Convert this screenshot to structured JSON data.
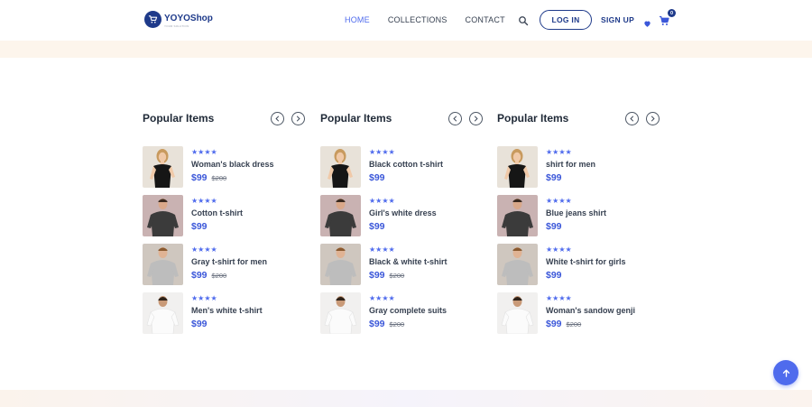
{
  "header": {
    "logo": {
      "brand_bold": "YOYO",
      "brand_rest": "Shop",
      "tagline": "YOUR SOLUTION"
    },
    "nav": [
      {
        "label": "HOME",
        "active": true
      },
      {
        "label": "COLLECTIONS",
        "active": false
      },
      {
        "label": "CONTACT",
        "active": false
      }
    ],
    "login_label": "LOG IN",
    "signup_label": "SIGN UP",
    "cart_count": "0",
    "icons": [
      "search-icon",
      "heart-icon",
      "cart-icon"
    ]
  },
  "colors": {
    "accent": "#4f6bed",
    "brand": "#1e3a8a",
    "band": "#fdf5ec"
  },
  "columns": [
    {
      "title": "Popular Items",
      "items": [
        {
          "rating": "★★★★",
          "name": "Woman's black dress",
          "price": "$99",
          "old_price": "$200",
          "image": "woman-black-dress"
        },
        {
          "rating": "★★★★",
          "name": "Cotton t-shirt",
          "price": "$99",
          "old_price": "",
          "image": "man-dark-tshirt"
        },
        {
          "rating": "★★★★",
          "name": "Gray t-shirt for men",
          "price": "$99",
          "old_price": "$200",
          "image": "man-gray-tshirt"
        },
        {
          "rating": "★★★★",
          "name": "Men's white t-shirt",
          "price": "$99",
          "old_price": "",
          "image": "man-white-tshirt"
        }
      ]
    },
    {
      "title": "Popular Items",
      "items": [
        {
          "rating": "★★★★",
          "name": "Black cotton t-shirt",
          "price": "$99",
          "old_price": "",
          "image": "woman-black-dress"
        },
        {
          "rating": "★★★★",
          "name": "Girl's white dress",
          "price": "$99",
          "old_price": "",
          "image": "man-dark-tshirt"
        },
        {
          "rating": "★★★★",
          "name": "Black & white t-shirt",
          "price": "$99",
          "old_price": "$200",
          "image": "man-gray-tshirt"
        },
        {
          "rating": "★★★★",
          "name": "Gray complete suits",
          "price": "$99",
          "old_price": "$200",
          "image": "man-white-tshirt"
        }
      ]
    },
    {
      "title": "Popular Items",
      "items": [
        {
          "rating": "★★★★",
          "name": "shirt for men",
          "price": "$99",
          "old_price": "",
          "image": "woman-black-dress"
        },
        {
          "rating": "★★★★",
          "name": "Blue jeans shirt",
          "price": "$99",
          "old_price": "",
          "image": "man-dark-tshirt"
        },
        {
          "rating": "★★★★",
          "name": "White t-shirt for girls",
          "price": "$99",
          "old_price": "",
          "image": "man-gray-tshirt"
        },
        {
          "rating": "★★★★",
          "name": "Woman's sandow genji",
          "price": "$99",
          "old_price": "$200",
          "image": "man-white-tshirt"
        }
      ]
    }
  ]
}
